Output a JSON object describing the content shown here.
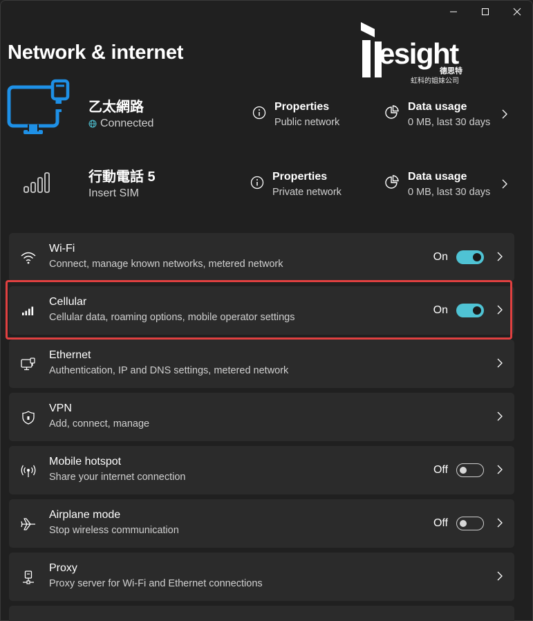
{
  "window": {
    "controls": [
      "minimize-icon",
      "maximize-icon",
      "close-icon"
    ]
  },
  "page": {
    "title": "Network & internet"
  },
  "logo": {
    "text": "esight",
    "cn_small": "德思特",
    "subtitle": "虹科的姐妹公司"
  },
  "connections": [
    {
      "name": "乙太網路",
      "status": "Connected",
      "icon": "ethernet-monitor-icon",
      "properties": {
        "label": "Properties",
        "sub": "Public network"
      },
      "data_usage": {
        "label": "Data usage",
        "sub": "0 MB, last 30 days"
      }
    },
    {
      "name": "行動電話 5",
      "status": "Insert SIM",
      "icon": "cellular-signal-icon",
      "properties": {
        "label": "Properties",
        "sub": "Private network"
      },
      "data_usage": {
        "label": "Data usage",
        "sub": "0 MB, last 30 days"
      }
    }
  ],
  "settings": [
    {
      "id": "wifi",
      "title": "Wi-Fi",
      "desc": "Connect, manage known networks, metered network",
      "state": "On",
      "icon": "wifi-icon"
    },
    {
      "id": "cellular",
      "title": "Cellular",
      "desc": "Cellular data, roaming options, mobile operator settings",
      "state": "On",
      "icon": "cellular-icon"
    },
    {
      "id": "ethernet",
      "title": "Ethernet",
      "desc": "Authentication, IP and DNS settings, metered network",
      "icon": "ethernet-icon"
    },
    {
      "id": "vpn",
      "title": "VPN",
      "desc": "Add, connect, manage",
      "icon": "vpn-shield-icon"
    },
    {
      "id": "hotspot",
      "title": "Mobile hotspot",
      "desc": "Share your internet connection",
      "state": "Off",
      "icon": "hotspot-icon"
    },
    {
      "id": "airplane",
      "title": "Airplane mode",
      "desc": "Stop wireless communication",
      "state": "Off",
      "icon": "airplane-icon"
    },
    {
      "id": "proxy",
      "title": "Proxy",
      "desc": "Proxy server for Wi-Fi and Ethernet connections",
      "icon": "proxy-icon"
    }
  ],
  "colors": {
    "accent": "#4fc3d4",
    "highlight": "#e04040",
    "background": "#202020",
    "card": "#2b2b2b",
    "ethernet_icon": "#1e90e6"
  }
}
